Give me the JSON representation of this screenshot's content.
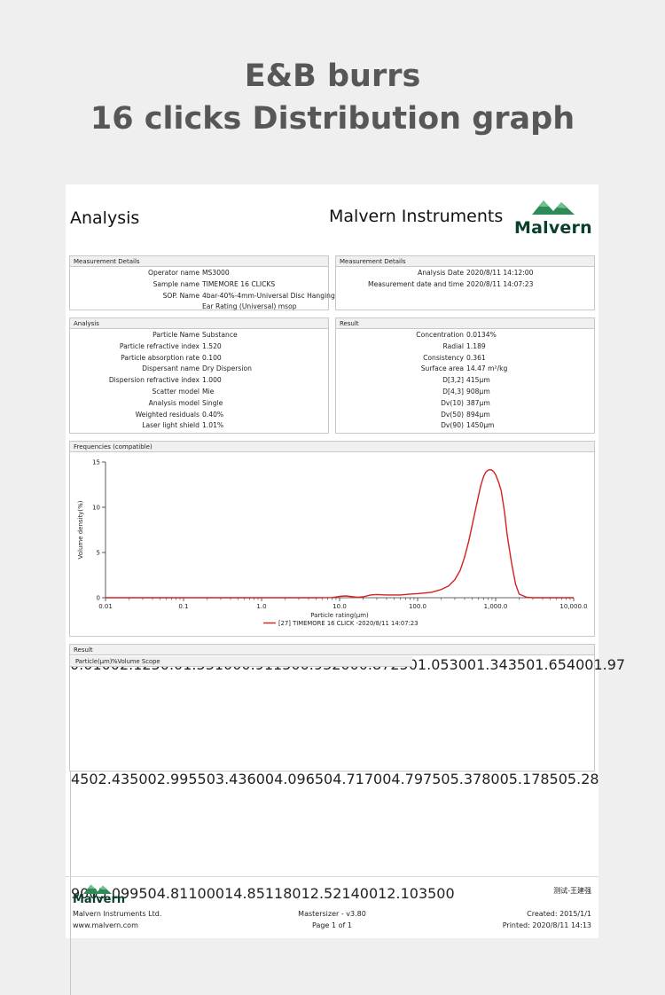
{
  "headline": {
    "line1": "E&B burrs",
    "line2": "16 clicks Distribution graph"
  },
  "report": {
    "title": "Analysis",
    "vendor": "Malvern Instruments",
    "logo_text": "Malvern",
    "logo_color": "#2e8b57"
  },
  "measurement_left": {
    "header": "Measurement Details",
    "rows": [
      {
        "k": "Operator name",
        "v": "MS3000"
      },
      {
        "k": "Sample name",
        "v": "TIMEMORE 16 CLICKS"
      },
      {
        "k": "SOP. Name",
        "v": "4bar-40%-4mm-Universal Disc Hanging"
      },
      {
        "k": "",
        "v": "Ear Rating (Universal) msop"
      }
    ]
  },
  "measurement_right": {
    "header": "Measurement Details",
    "rows": [
      {
        "k": "Analysis Date",
        "v": "2020/8/11 14:12:00"
      },
      {
        "k": "Measurement date and time",
        "v": "2020/8/11 14:07:23"
      }
    ]
  },
  "analysis": {
    "header": "Analysis",
    "rows": [
      {
        "k": "Particle Name",
        "v": "Substance"
      },
      {
        "k": "Particle refractive index",
        "v": "1.520"
      },
      {
        "k": "Particle absorption rate",
        "v": "0.100"
      },
      {
        "k": "Dispersant name",
        "v": "Dry Dispersion"
      },
      {
        "k": "Dispersion refractive index",
        "v": "1.000"
      },
      {
        "k": "Scatter model",
        "v": "Mie"
      },
      {
        "k": "Analysis model",
        "v": "Single"
      },
      {
        "k": "Weighted residuals",
        "v": "0.40%"
      },
      {
        "k": "Laser light shield",
        "v": "1.01%"
      }
    ]
  },
  "result_summary": {
    "header": "Result",
    "rows": [
      {
        "k": "Concentration",
        "v": "0.0134%"
      },
      {
        "k": "Radial",
        "v": "1.189"
      },
      {
        "k": "Consistency",
        "v": "0.361"
      },
      {
        "k": "Surface area",
        "v": "14.47 m²/kg"
      },
      {
        "k": "D[3,2]",
        "v": "415μm"
      },
      {
        "k": "D[4,3]",
        "v": "908μm"
      },
      {
        "k": "Dv(10)",
        "v": "387μm"
      },
      {
        "k": "Dv(50)",
        "v": "894μm"
      },
      {
        "k": "Dv(90)",
        "v": "1450μm"
      }
    ]
  },
  "frequencies": {
    "header": "Frequencies (compatible)"
  },
  "chart_data": {
    "type": "line",
    "xlabel": "Particle rating(μm)",
    "ylabel": "Volume density(%)",
    "x_scale": "log",
    "xlim": [
      0.01,
      10000
    ],
    "ylim": [
      0,
      15
    ],
    "x_ticks": [
      "0.01",
      "0.1",
      "1.0",
      "10.0",
      "100.0",
      "1,000.0",
      "10,000.0"
    ],
    "y_ticks": [
      "0",
      "5",
      "10",
      "15"
    ],
    "legend_position": "bottom",
    "series": [
      {
        "name": "[27] TIMEMORE 16 CLICK -2020/8/11 14:07:23",
        "color": "#d42020",
        "x": [
          0.01,
          0.1,
          1,
          5,
          8,
          10,
          12,
          15,
          17,
          20,
          25,
          30,
          40,
          60,
          80,
          100,
          150,
          200,
          250,
          300,
          350,
          400,
          450,
          500,
          550,
          600,
          650,
          700,
          750,
          800,
          850,
          900,
          950,
          1000,
          1100,
          1180,
          1300,
          1400,
          1600,
          1800,
          2000,
          2500,
          3000,
          3500,
          5000,
          10000
        ],
        "y": [
          0,
          0,
          0,
          0,
          0.02,
          0.15,
          0.2,
          0.1,
          0.05,
          0.1,
          0.3,
          0.35,
          0.3,
          0.3,
          0.4,
          0.45,
          0.6,
          0.9,
          1.3,
          2.0,
          3.0,
          4.5,
          6.2,
          8.0,
          9.7,
          11.2,
          12.5,
          13.4,
          13.9,
          14.1,
          14.15,
          14.1,
          13.9,
          13.6,
          12.7,
          11.8,
          9.5,
          7.0,
          3.8,
          1.5,
          0.4,
          0.05,
          0,
          0,
          0,
          0
        ]
      }
    ]
  },
  "result_table": {
    "header": "Result",
    "col_headers": [
      "Particle(μm)",
      "%Volume Scope"
    ],
    "groups": [
      [
        {
          "p": "0.0100",
          "v": "2.12"
        },
        {
          "p": "50.0",
          "v": "1.53"
        },
        {
          "p": "100",
          "v": "0.91"
        },
        {
          "p": "150",
          "v": "0.93"
        },
        {
          "p": "200",
          "v": "0.87"
        },
        {
          "p": "250",
          "v": "1.05"
        },
        {
          "p": "300",
          "v": "1.34"
        },
        {
          "p": "350",
          "v": "1.65"
        },
        {
          "p": "400",
          "v": "1.97"
        }
      ],
      [
        {
          "p": "450",
          "v": "2.43"
        },
        {
          "p": "500",
          "v": "2.99"
        },
        {
          "p": "550",
          "v": "3.43"
        },
        {
          "p": "600",
          "v": "4.09"
        },
        {
          "p": "650",
          "v": "4.71"
        },
        {
          "p": "700",
          "v": "4.79"
        },
        {
          "p": "750",
          "v": "5.37"
        },
        {
          "p": "800",
          "v": "5.17"
        },
        {
          "p": "850",
          "v": "5.28"
        }
      ],
      [
        {
          "p": "900",
          "v": "5.09"
        },
        {
          "p": "950",
          "v": "4.81"
        },
        {
          "p": "1000",
          "v": "14.85"
        },
        {
          "p": "1180",
          "v": "12.52"
        },
        {
          "p": "1400",
          "v": "12.10"
        },
        {
          "p": "3500",
          "v": ""
        }
      ]
    ]
  },
  "footer": {
    "logo_text": "Malvern",
    "company": "Malvern Instruments Ltd.",
    "website": "www.malvern.com",
    "software": "Mastersizer - v3.80",
    "page": "Page 1 of 1",
    "tester": "测试-王建强",
    "created": "Created:  2015/1/1",
    "printed": "Printed:  2020/8/11 14:13"
  }
}
